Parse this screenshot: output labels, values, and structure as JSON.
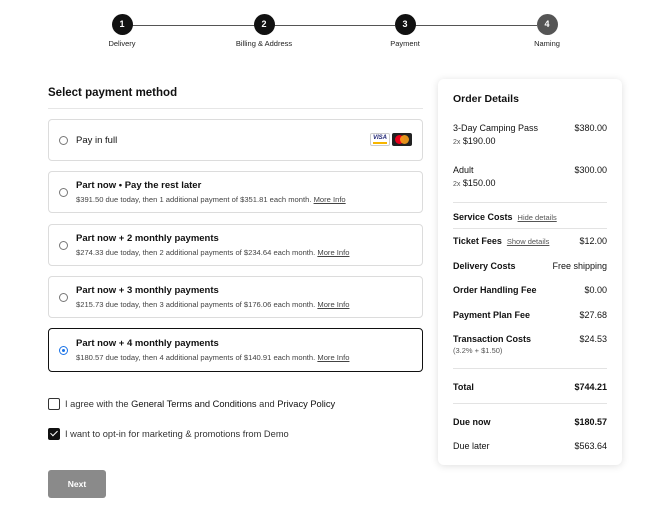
{
  "stepper": {
    "steps": [
      {
        "number": "1",
        "label": "Delivery"
      },
      {
        "number": "2",
        "label": "Billing & Address"
      },
      {
        "number": "3",
        "label": "Payment"
      },
      {
        "number": "4",
        "label": "Naming"
      }
    ]
  },
  "payment": {
    "title": "Select payment method",
    "selected_index": 4,
    "options": [
      {
        "title": "Pay in full",
        "desc": "",
        "more": ""
      },
      {
        "title": "Part now • Pay the rest later",
        "desc": "$391.50 due today, then 1 additional payment of $351.81 each month.",
        "more": "More Info"
      },
      {
        "title": "Part now + 2 monthly payments",
        "desc": "$274.33 due today, then 2 additional payments of $234.64 each month.",
        "more": "More Info"
      },
      {
        "title": "Part now + 3 monthly payments",
        "desc": "$215.73 due today, then 3 additional payments of $176.06 each month.",
        "more": "More Info"
      },
      {
        "title": "Part now + 4 monthly payments",
        "desc": "$180.57 due today, then 4 additional payments of $140.91 each month.",
        "more": "More Info"
      }
    ],
    "card_icons": [
      "visa-card-icon",
      "mastercard-icon"
    ],
    "visa_text": "VISA"
  },
  "consents": {
    "terms": {
      "prefix": "I agree with the",
      "link1": "General Terms and Conditions",
      "and": "and",
      "link2": "Privacy Policy",
      "checked": false
    },
    "marketing": {
      "label": "I want to opt-in for marketing & promotions from Demo",
      "checked": true
    }
  },
  "next_button": "Next",
  "order": {
    "title": "Order Details",
    "items": [
      {
        "name": "3-Day Camping Pass",
        "total": "$380.00",
        "qty": "2x",
        "unit": "$190.00"
      },
      {
        "name": "Adult",
        "total": "$300.00",
        "qty": "2x",
        "unit": "$150.00"
      }
    ],
    "service_costs": {
      "label": "Service Costs",
      "link": "Hide details"
    },
    "ticket_fees": {
      "label": "Ticket Fees",
      "link": "Show details",
      "value": "$12.00"
    },
    "delivery": {
      "label": "Delivery Costs",
      "value": "Free shipping"
    },
    "handling": {
      "label": "Order Handling Fee",
      "value": "$0.00"
    },
    "plan_fee": {
      "label": "Payment Plan Fee",
      "value": "$27.68"
    },
    "transaction": {
      "label": "Transaction Costs",
      "value": "$24.53",
      "detail": "(3.2% + $1.50)"
    },
    "total": {
      "label": "Total",
      "value": "$744.21"
    },
    "due_now": {
      "label": "Due now",
      "value": "$180.57"
    },
    "due_later": {
      "label": "Due later",
      "value": "$563.64"
    }
  },
  "colors": {
    "accent": "#111111",
    "radio_selected": "#1a73e8",
    "button_disabled": "#8a8a8a"
  }
}
